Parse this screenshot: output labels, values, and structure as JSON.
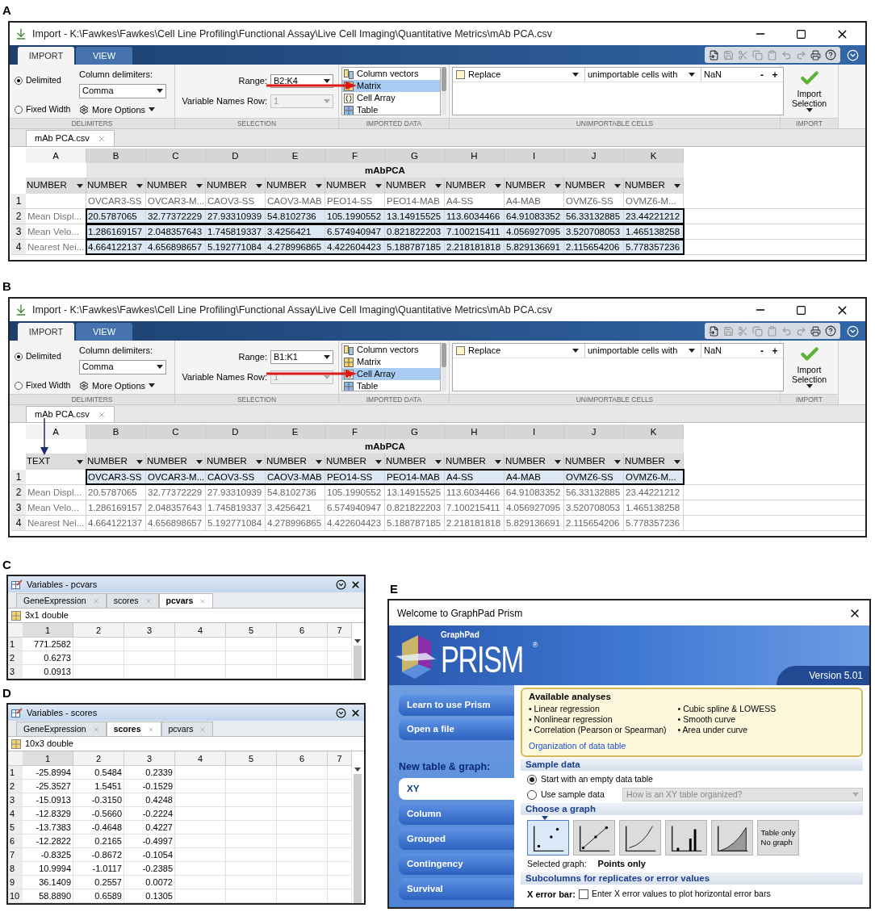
{
  "import_panels": [
    {
      "label": "A",
      "title": "Import - K:\\Fawkes\\Fawkes\\Cell Line Profiling\\Functional Assay\\Live Cell Imaging\\Quantitative Metrics\\mAb PCA.csv",
      "tabs": [
        {
          "label": "IMPORT",
          "selected": true
        },
        {
          "label": "VIEW",
          "selected": false
        }
      ],
      "delimiter_options": [
        {
          "label": "Delimited",
          "selected": true
        },
        {
          "label": "Fixed Width",
          "selected": false
        }
      ],
      "column_delimiters_label": "Column delimiters:",
      "delimiter": "Comma",
      "more_options": "More Options",
      "range_label": "Range:",
      "range": "B2:K4",
      "var_names_label": "Variable Names Row:",
      "var_names_row": "1",
      "var_names_disabled": true,
      "data_types": [
        {
          "kind": "vectors",
          "label": "Column vectors",
          "selected": false
        },
        {
          "kind": "matrix",
          "label": "Matrix",
          "selected": true
        },
        {
          "kind": "cells",
          "label": "Cell Array",
          "selected": false
        },
        {
          "kind": "table",
          "label": "Table",
          "selected": false
        }
      ],
      "rule_checked": false,
      "replace": "Replace",
      "unimportable_label": "unimportable cells with",
      "replacement": "NaN",
      "rule_buttons": [
        "-",
        "+"
      ],
      "import_button": "Import Selection",
      "sections": [
        "DELIMITERS",
        "SELECTION",
        "IMPORTED DATA",
        "UNIMPORTABLE CELLS",
        "IMPORT"
      ],
      "document_tab": "mAb PCA.csv",
      "column_arrow": false,
      "table": {
        "columns": [
          "A",
          "B",
          "C",
          "D",
          "E",
          "F",
          "G",
          "H",
          "I",
          "J",
          "K"
        ],
        "group_title": "mAbPCA",
        "types": [
          "NUMBER",
          "NUMBER",
          "NUMBER",
          "NUMBER",
          "NUMBER",
          "NUMBER",
          "NUMBER",
          "NUMBER",
          "NUMBER",
          "NUMBER",
          "NUMBER"
        ],
        "rows": [
          {
            "number": "1",
            "selected": false,
            "cells": [
              "",
              "OVCAR3-SS",
              "OVCAR3-M...",
              "CAOV3-SS",
              "CAOV3-MAB",
              "PEO14-SS",
              "PEO14-MAB",
              "A4-SS",
              "A4-MAB",
              "OVMZ6-SS",
              "OVMZ6-M..."
            ]
          },
          {
            "number": "2",
            "selected": true,
            "cells": [
              "Mean Displ...",
              "20.5787065",
              "32.77372229",
              "27.93310939",
              "54.8102736",
              "105.1990552",
              "13.14915525",
              "113.6034466",
              "64.91083352",
              "56.33132885",
              "23.44221212"
            ]
          },
          {
            "number": "3",
            "selected": true,
            "cells": [
              "Mean Velo...",
              "1.286169157",
              "2.048357643",
              "1.745819337",
              "3.4256421",
              "6.574940947",
              "0.821822203",
              "7.100215411",
              "4.056927095",
              "3.520708053",
              "1.465138258"
            ]
          },
          {
            "number": "4",
            "selected": true,
            "cells": [
              "Nearest Nei...",
              "4.664122137",
              "4.656898657",
              "5.192771084",
              "4.278996865",
              "4.422604423",
              "5.188787185",
              "2.218181818",
              "5.829136691",
              "2.115654206",
              "5.778357236"
            ]
          }
        ]
      }
    },
    {
      "label": "B",
      "title": "Import - K:\\Fawkes\\Fawkes\\Cell Line Profiling\\Functional Assay\\Live Cell Imaging\\Quantitative Metrics\\mAb PCA.csv",
      "tabs": [
        {
          "label": "IMPORT",
          "selected": true
        },
        {
          "label": "VIEW",
          "selected": false
        }
      ],
      "delimiter_options": [
        {
          "label": "Delimited",
          "selected": true
        },
        {
          "label": "Fixed Width",
          "selected": false
        }
      ],
      "column_delimiters_label": "Column delimiters:",
      "delimiter": "Comma",
      "more_options": "More Options",
      "range_label": "Range:",
      "range": "B1:K1",
      "var_names_label": "Variable Names Row:",
      "var_names_row": "1",
      "var_names_disabled": true,
      "data_types": [
        {
          "kind": "vectors",
          "label": "Column vectors",
          "selected": false
        },
        {
          "kind": "matrix",
          "label": "Matrix",
          "selected": false
        },
        {
          "kind": "cells",
          "label": "Cell Array",
          "selected": true
        },
        {
          "kind": "table",
          "label": "Table",
          "selected": false
        }
      ],
      "rule_checked": false,
      "replace": "Replace",
      "unimportable_label": "unimportable cells with",
      "replacement": "NaN",
      "rule_buttons": [
        "-",
        "+"
      ],
      "import_button": "Import Selection",
      "sections": [
        "DELIMITERS",
        "SELECTION",
        "IMPORTED DATA",
        "UNIMPORTABLE CELLS",
        "IMPORT"
      ],
      "document_tab": "mAb PCA.csv",
      "column_arrow": true,
      "table": {
        "columns": [
          "A",
          "B",
          "C",
          "D",
          "E",
          "F",
          "G",
          "H",
          "I",
          "J",
          "K"
        ],
        "group_title": "mAbPCA",
        "types": [
          "TEXT",
          "NUMBER",
          "NUMBER",
          "NUMBER",
          "NUMBER",
          "NUMBER",
          "NUMBER",
          "NUMBER",
          "NUMBER",
          "NUMBER",
          "NUMBER"
        ],
        "rows": [
          {
            "number": "1",
            "selected": true,
            "cells": [
              "",
              "OVCAR3-SS",
              "OVCAR3-M...",
              "CAOV3-SS",
              "CAOV3-MAB",
              "PEO14-SS",
              "PEO14-MAB",
              "A4-SS",
              "A4-MAB",
              "OVMZ6-SS",
              "OVMZ6-M..."
            ]
          },
          {
            "number": "2",
            "selected": false,
            "cells": [
              "Mean Displ...",
              "20.5787065",
              "32.77372229",
              "27.93310939",
              "54.8102736",
              "105.1990552",
              "13.14915525",
              "113.6034466",
              "64.91083352",
              "56.33132885",
              "23.44221212"
            ]
          },
          {
            "number": "3",
            "selected": false,
            "cells": [
              "Mean Velo...",
              "1.286169157",
              "2.048357643",
              "1.745819337",
              "3.4256421",
              "6.574940947",
              "0.821822203",
              "7.100215411",
              "4.056927095",
              "3.520708053",
              "1.465138258"
            ]
          },
          {
            "number": "4",
            "selected": false,
            "cells": [
              "Nearest Nei...",
              "4.664122137",
              "4.656898657",
              "5.192771084",
              "4.278996865",
              "4.422604423",
              "5.188787185",
              "2.218181818",
              "5.829136691",
              "2.115654206",
              "5.778357236"
            ]
          }
        ]
      }
    }
  ],
  "variable_panels": [
    {
      "label": "C",
      "title": "Variables - pcvars",
      "tabs": [
        {
          "label": "GeneExpression",
          "selected": false
        },
        {
          "label": "scores",
          "selected": false
        },
        {
          "label": "pcvars",
          "selected": true
        }
      ],
      "size": "3x1 double",
      "columns": [
        "1",
        "2",
        "3",
        "4",
        "5",
        "6",
        "7"
      ],
      "rows": [
        {
          "number": "1",
          "values": [
            "771.2582"
          ]
        },
        {
          "number": "2",
          "values": [
            "0.6273"
          ]
        },
        {
          "number": "3",
          "values": [
            "0.0913"
          ]
        }
      ]
    },
    {
      "label": "D",
      "title": "Variables - scores",
      "tabs": [
        {
          "label": "GeneExpression",
          "selected": false
        },
        {
          "label": "scores",
          "selected": true
        },
        {
          "label": "pcvars",
          "selected": false
        }
      ],
      "size": "10x3 double",
      "columns": [
        "1",
        "2",
        "3",
        "4",
        "5",
        "6",
        "7"
      ],
      "rows": [
        {
          "number": "1",
          "values": [
            "-25.8994",
            "0.5484",
            "0.2339"
          ]
        },
        {
          "number": "2",
          "values": [
            "-25.3527",
            "1.5451",
            "-0.1529"
          ]
        },
        {
          "number": "3",
          "values": [
            "-15.0913",
            "-0.3150",
            "0.4248"
          ]
        },
        {
          "number": "4",
          "values": [
            "-12.8329",
            "-0.5660",
            "-0.2224"
          ]
        },
        {
          "number": "5",
          "values": [
            "-13.7383",
            "-0.4648",
            "0.4227"
          ]
        },
        {
          "number": "6",
          "values": [
            "-12.2822",
            "0.2165",
            "-0.4997"
          ]
        },
        {
          "number": "7",
          "values": [
            "-0.8325",
            "-0.8672",
            "-0.1054"
          ]
        },
        {
          "number": "8",
          "values": [
            "10.9994",
            "-1.0117",
            "-0.2385"
          ]
        },
        {
          "number": "9",
          "values": [
            "36.1409",
            "0.2557",
            "0.0072"
          ]
        },
        {
          "number": "10",
          "values": [
            "58.8890",
            "0.6589",
            "0.1305"
          ]
        }
      ]
    }
  ],
  "prism": {
    "label": "E",
    "title": "Welcome to GraphPad Prism",
    "logo_brand": "GraphPad",
    "logo_name": "PRISM",
    "registered_mark": "®",
    "version": "Version 5.01",
    "side_buttons": [
      "Learn to use Prism",
      "Open a file"
    ],
    "new_table_heading": "New table & graph:",
    "table_types": [
      {
        "label": "XY",
        "selected": true
      },
      {
        "label": "Column",
        "selected": false
      },
      {
        "label": "Grouped",
        "selected": false
      },
      {
        "label": "Contingency",
        "selected": false
      },
      {
        "label": "Survival",
        "selected": false
      }
    ],
    "analyses": {
      "title": "Available analyses",
      "columns": [
        [
          "• Linear regression",
          "• Nonlinear regression",
          "• Correlation (Pearson or Spearman)"
        ],
        [
          "• Cubic spline & LOWESS",
          "• Smooth curve",
          "• Area under curve"
        ]
      ],
      "link": "Organization of data table"
    },
    "sample_data": {
      "heading": "Sample data",
      "options": [
        {
          "label": "Start with an empty data table",
          "selected": true
        },
        {
          "label": "Use sample data",
          "selected": false
        }
      ],
      "dropdown": "How is an XY table organized?",
      "dropdown_disabled": true
    },
    "choose_graph": {
      "heading": "Choose a graph",
      "options": [
        {
          "kind": "points",
          "selected": true
        },
        {
          "kind": "line",
          "selected": false
        },
        {
          "kind": "curve",
          "selected": false
        },
        {
          "kind": "bars",
          "selected": false
        },
        {
          "kind": "area",
          "selected": false
        },
        {
          "kind": "text",
          "lines": [
            "Table only",
            "No graph"
          ],
          "selected": false
        }
      ],
      "selected_label": "Selected graph:",
      "selected_value": "Points only"
    },
    "subcolumns": {
      "heading": "Subcolumns for replicates or error values",
      "x_error_label": "X error bar:",
      "checkbox_label": "Enter X error values to plot horizontal error bars",
      "checked": false
    }
  }
}
